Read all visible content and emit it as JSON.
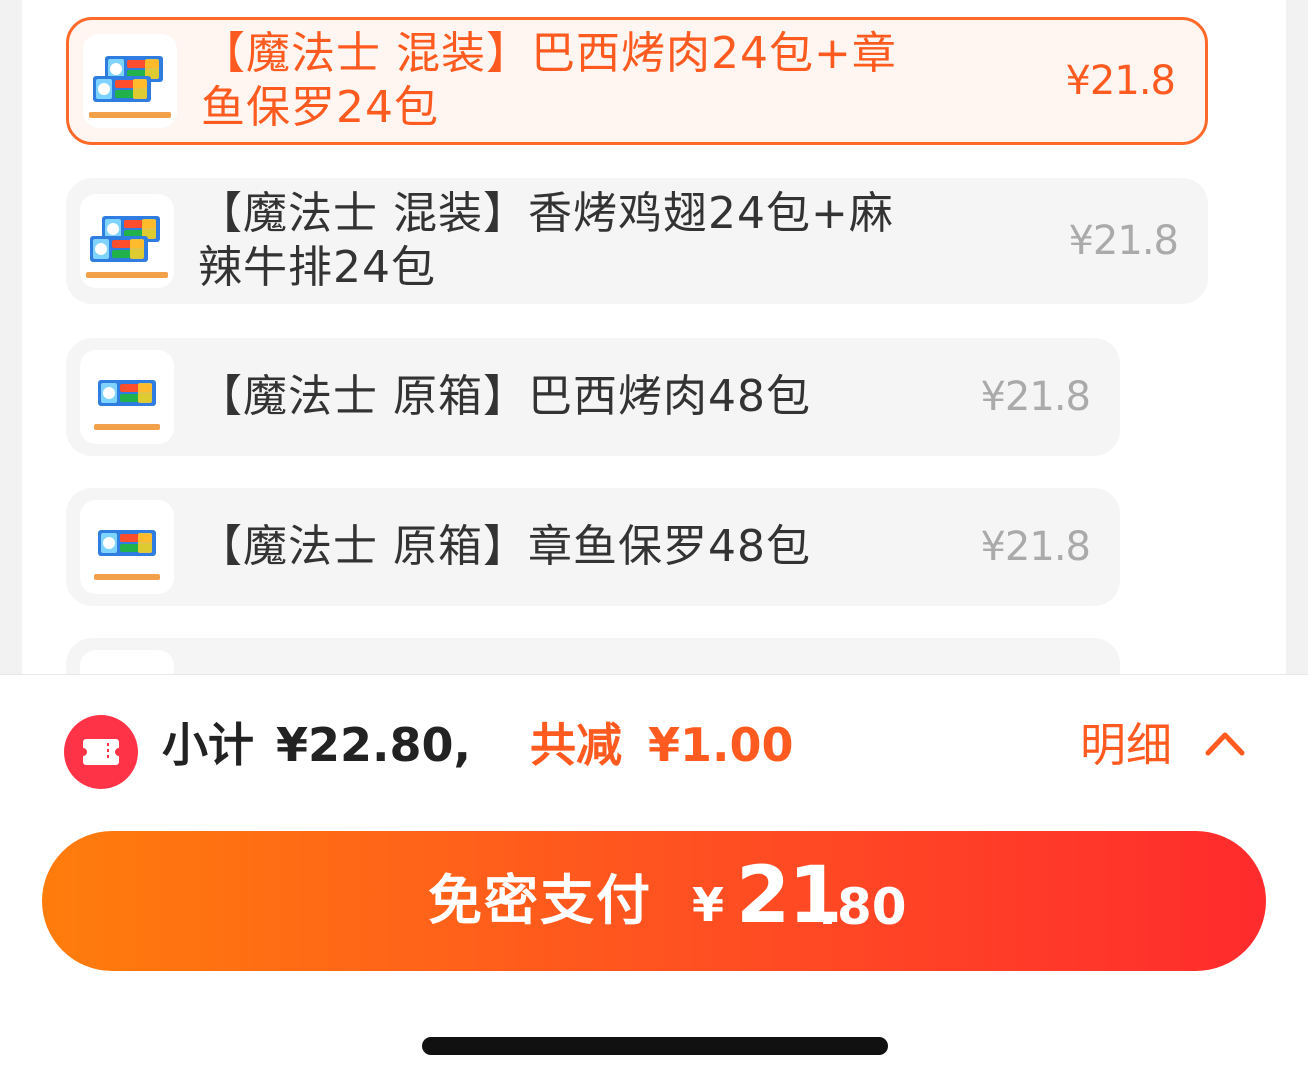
{
  "options": [
    {
      "title_line1": "【魔法士 混装】巴西烤肉24包+章",
      "title_line2": "鱼保罗24包",
      "price": "¥21.8",
      "selected": true
    },
    {
      "title_line1": "【魔法士 混装】香烤鸡翅24包+麻",
      "title_line2": "辣牛排24包",
      "price": "¥21.8",
      "selected": false
    },
    {
      "title_line1": "【魔法士 原箱】巴西烤肉48包",
      "price": "¥21.8",
      "selected": false
    },
    {
      "title_line1": "【魔法士 原箱】章鱼保罗48包",
      "price": "¥21.8",
      "selected": false
    }
  ],
  "summary": {
    "subtotal_label": "小计",
    "subtotal_value": "¥22.80,",
    "discount_label": "共减",
    "discount_value": "¥1.00",
    "detail_label": "明细"
  },
  "pay_button": {
    "label": "免密支付",
    "currency": "¥",
    "amount_int": "21",
    "amount_dec": ".80"
  },
  "colors": {
    "accent": "#ff5a1f",
    "selected_border": "#ff6a2b",
    "coupon_icon": "#ff3348",
    "pay_gradient_start": "#ff7d0c",
    "pay_gradient_end": "#ff2b2d",
    "price_muted": "#aaaaaa"
  },
  "icons": {
    "coupon": "ticket-icon",
    "detail": "chevron-up-icon"
  }
}
